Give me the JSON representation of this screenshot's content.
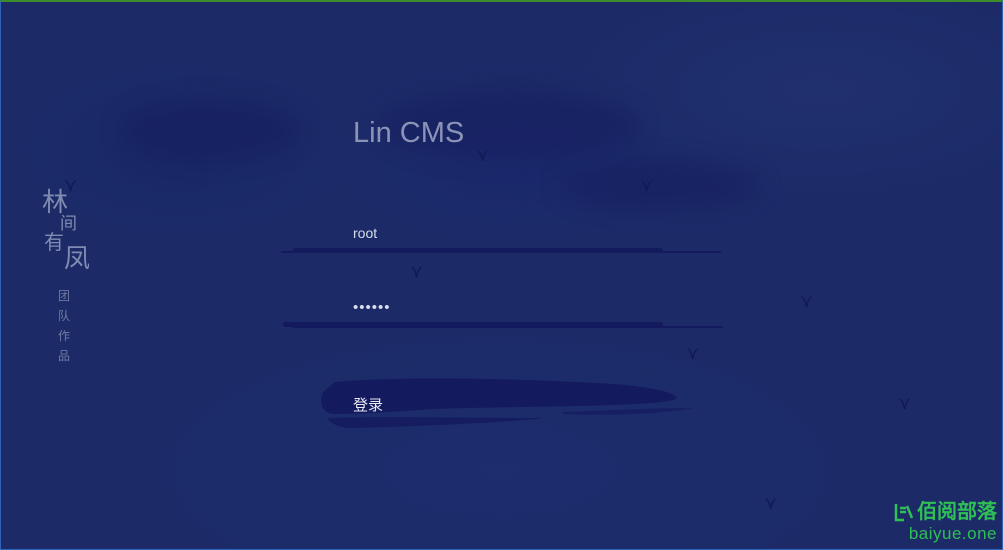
{
  "app": {
    "title": "Lin CMS"
  },
  "branding": {
    "seal_chars": [
      "林",
      "间",
      "有",
      "凤"
    ],
    "seal_subtitle": "团队作品"
  },
  "login": {
    "username_value": "root",
    "password_value": "••••••",
    "submit_label": "登录"
  },
  "watermark": {
    "logo_glyph": "佰",
    "name": "佰阅部落",
    "domain": "baiyue.one",
    "color": "#2fbf55"
  },
  "colors": {
    "background": "#1c2b68",
    "ink": "#141a5e",
    "title_text": "#8b93b6"
  },
  "icons": [
    "bird-icon",
    "brush-stroke-decoration",
    "baiyue-logo-icon"
  ]
}
